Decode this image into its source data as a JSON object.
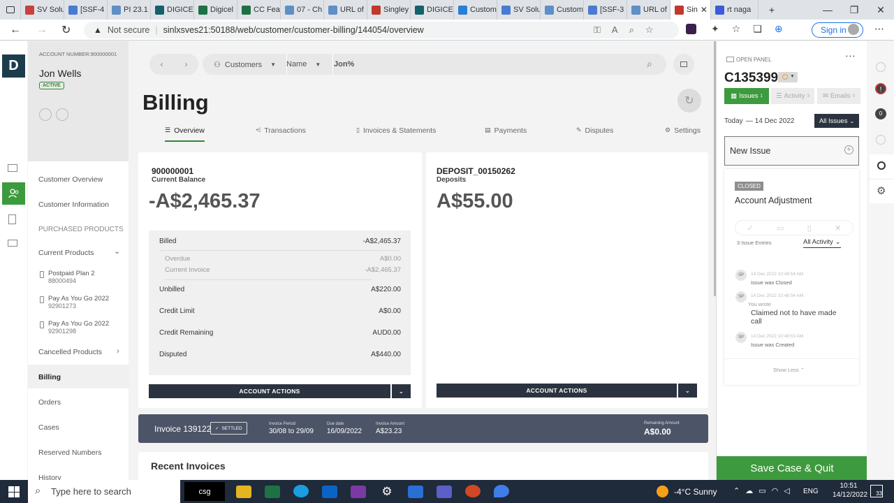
{
  "browser": {
    "tabs": [
      "SV Solu",
      "[SSF-4",
      "PI 23.1",
      "DIGICE",
      "Digicel",
      "CC Fea",
      "07 - Ch",
      "URL of",
      "Singley",
      "DIGICE",
      "Custom",
      "SV Solu",
      "Custom",
      "[SSF-3",
      "URL of",
      "Sin",
      "rt naga"
    ],
    "not_secure": "Not secure",
    "url": "sinlxsves21:50188/web/customer/customer-billing/144054/overview",
    "sign_in": "Sign in"
  },
  "app": {
    "logo": "D",
    "account_label": "ACCOUNT NUMBER:900000001",
    "customer_name": "Jon Wells",
    "status": "ACTIVE"
  },
  "leftnav": {
    "customer_overview": "Customer Overview",
    "customer_information": "Customer Information",
    "purchased_products": "PURCHASED PRODUCTS",
    "current_products": "Current Products",
    "products": [
      {
        "name": "Postpaid Plan 2",
        "number": "88000494"
      },
      {
        "name": "Pay As You Go 2022",
        "number": "92901273"
      },
      {
        "name": "Pay As You Go 2022",
        "number": "92901298"
      }
    ],
    "cancelled_products": "Cancelled Products",
    "billing": "Billing",
    "orders": "Orders",
    "cases": "Cases",
    "reserved_numbers": "Reserved Numbers",
    "history": "History"
  },
  "search": {
    "customers": "Customers",
    "name": "Name",
    "query": "Jon%"
  },
  "page": {
    "title": "Billing",
    "tabs": [
      "Overview",
      "Transactions",
      "Invoices & Statements",
      "Payments",
      "Disputes",
      "Settings"
    ]
  },
  "balance": {
    "account": "900000001",
    "label": "Current Balance",
    "amount": "-A$2,465.37",
    "rows": [
      {
        "label": "Billed",
        "value": "-A$2,465.37"
      },
      {
        "label": "Overdue",
        "value": "A$0.00"
      },
      {
        "label": "Current Invoice",
        "value": "-A$2,465.37"
      },
      {
        "label": "Unbilled",
        "value": "A$220.00"
      },
      {
        "label": "Credit Limit",
        "value": "A$0.00"
      },
      {
        "label": "Credit Remaining",
        "value": "AUD0.00"
      },
      {
        "label": "Disputed",
        "value": "A$440.00"
      }
    ],
    "action": "ACCOUNT ACTIONS"
  },
  "deposit": {
    "id": "DEPOSIT_00150262",
    "label": "Deposits",
    "amount": "A$55.00",
    "action": "ACCOUNT ACTIONS"
  },
  "invoice": {
    "title": "Invoice 139122",
    "status": "SETTLED",
    "period_label": "Invoice Period",
    "period": "30/08 to 29/09",
    "due_label": "Due date",
    "due": "16/09/2022",
    "amount_label": "Invoice Amount",
    "amount": "A$23.23",
    "remaining_label": "Remaining Amount",
    "remaining": "A$0.00"
  },
  "recent_invoices": "Recent Invoices",
  "case_panel": {
    "open_panel": "OPEN PANEL",
    "case_id": "C135399",
    "tabs": [
      {
        "label": "Issues",
        "count": "1"
      },
      {
        "label": "Activity",
        "count": "3"
      },
      {
        "label": "Emails",
        "count": "0"
      }
    ],
    "today": "Today",
    "date": "— 14 Dec 2022",
    "filter": "All Issues",
    "new_issue": "New Issue",
    "issue_status": "CLOSED",
    "issue_title": "Account Adjustment",
    "entries": "3 Issue Entries",
    "activity_filter": "All Activity",
    "timeline": [
      {
        "avatar": "SP",
        "time": "14 Dec 2022 10:48:54 AM",
        "text": "Issue was Closed"
      },
      {
        "avatar": "SP",
        "time": "14 Dec 2022 10:48:54 AM",
        "sub": "You wrote",
        "note": "Claimed not to have made call"
      },
      {
        "avatar": "SP",
        "time": "14 Dec 2022 10:48:53 AM",
        "text": "Issue was Created"
      }
    ],
    "show_less": "Show Less",
    "save": "Save Case & Quit"
  },
  "right_rail": {
    "badge1": "!",
    "badge2": "0"
  },
  "taskbar": {
    "search_placeholder": "Type here to search",
    "weather": "-4°C  Sunny",
    "lang": "ENG",
    "time": "10:51",
    "date": "14/12/2022",
    "notif": "33",
    "csg": "csg"
  }
}
